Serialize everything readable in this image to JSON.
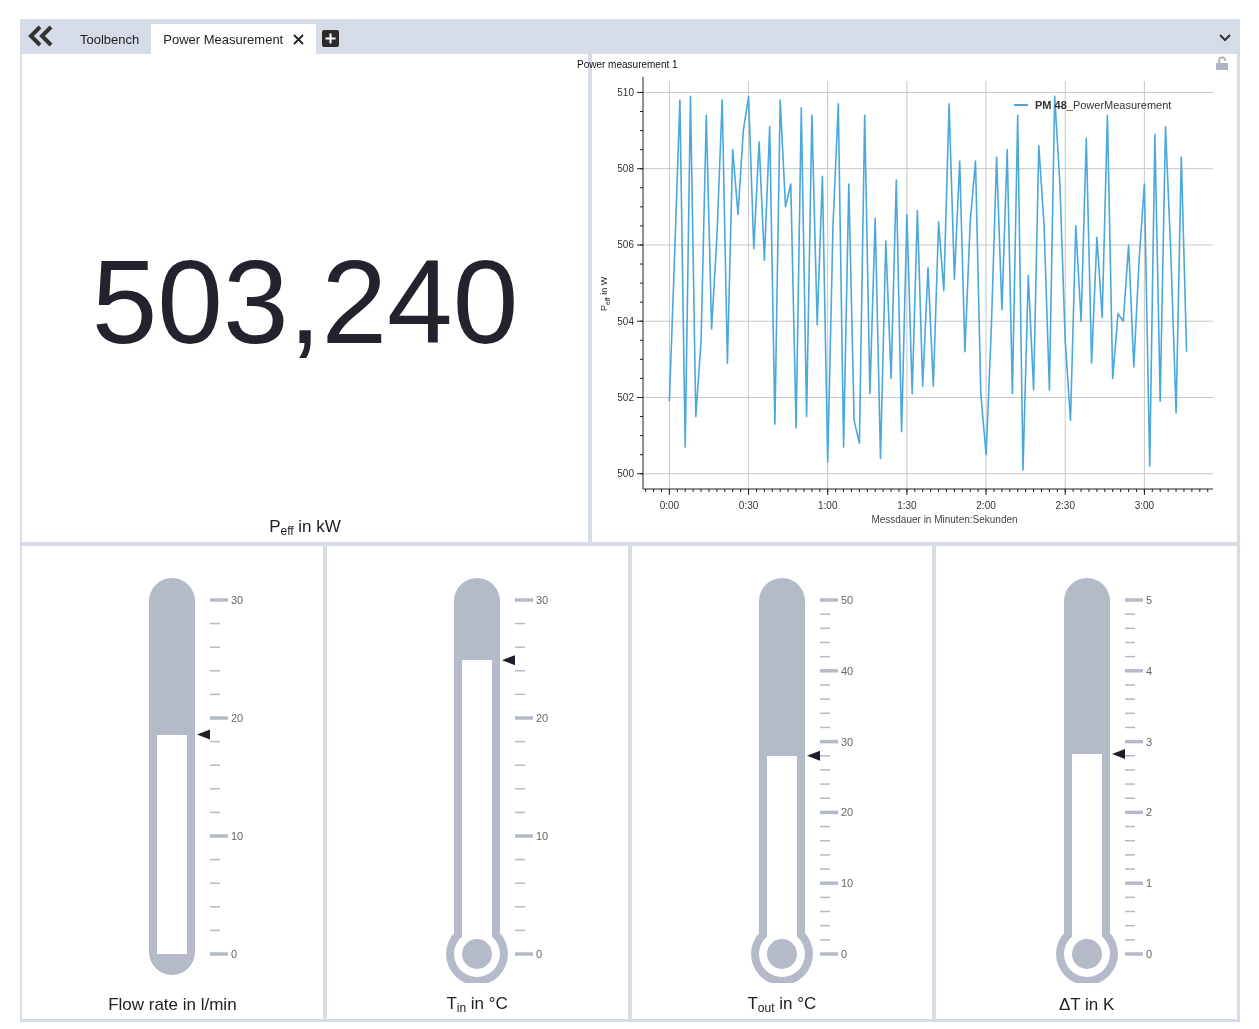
{
  "tabs": [
    {
      "label": "Toolbench",
      "selected": false,
      "closable": false
    },
    {
      "label": "Power Measurement",
      "selected": true,
      "closable": true
    }
  ],
  "value_panel": {
    "value": "503,240",
    "label": "P$_{eff}$ in kW"
  },
  "chart_panel": {
    "title": "Power measurement  1",
    "chart_data": {
      "type": "line",
      "grid": true,
      "xlabel": "Messdauer in Minuten:Sekunden",
      "ylabel": "P$_{eff}$ in W",
      "x": [
        0,
        2,
        4,
        6,
        8,
        10,
        12,
        14,
        16,
        18,
        20,
        22,
        24,
        26,
        28,
        30,
        32,
        34,
        36,
        38,
        40,
        42,
        44,
        46,
        48,
        50,
        52,
        54,
        56,
        58,
        60,
        62,
        64,
        66,
        68,
        70,
        72,
        74,
        76,
        78,
        80,
        82,
        84,
        86,
        88,
        90,
        92,
        94,
        96,
        98,
        100,
        102,
        104,
        106,
        108,
        110,
        112,
        114,
        116,
        118,
        120,
        122,
        124,
        126,
        128,
        130,
        132,
        134,
        136,
        138,
        140,
        142,
        144,
        146,
        148,
        150,
        152,
        154,
        156,
        158,
        160,
        162,
        164,
        166,
        168,
        170,
        172,
        174,
        176,
        178,
        180,
        182,
        184,
        186,
        188,
        190,
        192,
        194,
        196
      ],
      "series": [
        {
          "name": "**PM 48**_PowerMeasurement",
          "color": "#4aa8dc",
          "values": [
            501.9,
            505.8,
            509.8,
            500.7,
            509.9,
            501.5,
            503.5,
            509.4,
            503.8,
            506.2,
            509.8,
            502.9,
            508.5,
            506.8,
            509.0,
            509.9,
            505.9,
            508.7,
            505.6,
            509.1,
            501.3,
            509.8,
            507.0,
            507.6,
            501.2,
            509.6,
            501.5,
            509.4,
            503.9,
            507.8,
            500.3,
            506.5,
            509.7,
            500.7,
            507.6,
            501.4,
            500.8,
            509.4,
            502.1,
            506.7,
            500.4,
            506.1,
            502.5,
            507.7,
            501.1,
            506.8,
            502.1,
            506.9,
            502.3,
            505.4,
            502.3,
            506.6,
            504.8,
            509.7,
            505.1,
            508.2,
            503.2,
            506.6,
            508.2,
            502.1,
            500.5,
            503.8,
            508.3,
            504.3,
            508.5,
            502.1,
            509.4,
            500.1,
            505.2,
            502.2,
            508.6,
            506.5,
            502.2,
            509.9,
            507.6,
            503.5,
            501.4,
            506.5,
            504.0,
            508.8,
            502.9,
            506.2,
            504.1,
            509.4,
            502.5,
            504.2,
            504.0,
            506.0,
            502.8,
            505.6,
            507.6,
            500.2,
            508.9,
            501.9,
            509.1,
            505.8,
            501.6,
            508.3,
            503.2
          ]
        }
      ],
      "xlim": [
        -10,
        206
      ],
      "ylim": [
        499.6,
        510.3
      ],
      "xticks": [
        {
          "value": 0,
          "label": "0:00"
        },
        {
          "value": 30,
          "label": "0:30"
        },
        {
          "value": 60,
          "label": "1:00"
        },
        {
          "value": 90,
          "label": "1:30"
        },
        {
          "value": 120,
          "label": "2:00"
        },
        {
          "value": 150,
          "label": "2:30"
        },
        {
          "value": 180,
          "label": "3:00"
        }
      ],
      "yticks": [
        500,
        502,
        504,
        506,
        508,
        510
      ]
    }
  },
  "gauges": [
    {
      "kind": "tube",
      "label": "Flow rate in l/min",
      "ticks": [
        "30",
        "20",
        "10",
        "0"
      ],
      "level": 0.62
    },
    {
      "kind": "bulb",
      "label": "T$_{in}$ in °C",
      "ticks": [
        "30",
        "20",
        "10",
        "0"
      ],
      "level": 0.83
    },
    {
      "kind": "bulb",
      "label": "T$_{out}$ in °C",
      "ticks": [
        "50",
        "40",
        "30",
        "20",
        "10",
        "0"
      ],
      "level": 0.56
    },
    {
      "kind": "bulb",
      "label": "ΔT in K",
      "ticks": [
        "5",
        "4",
        "3",
        "2",
        "1",
        "0"
      ],
      "level": 0.565
    }
  ]
}
